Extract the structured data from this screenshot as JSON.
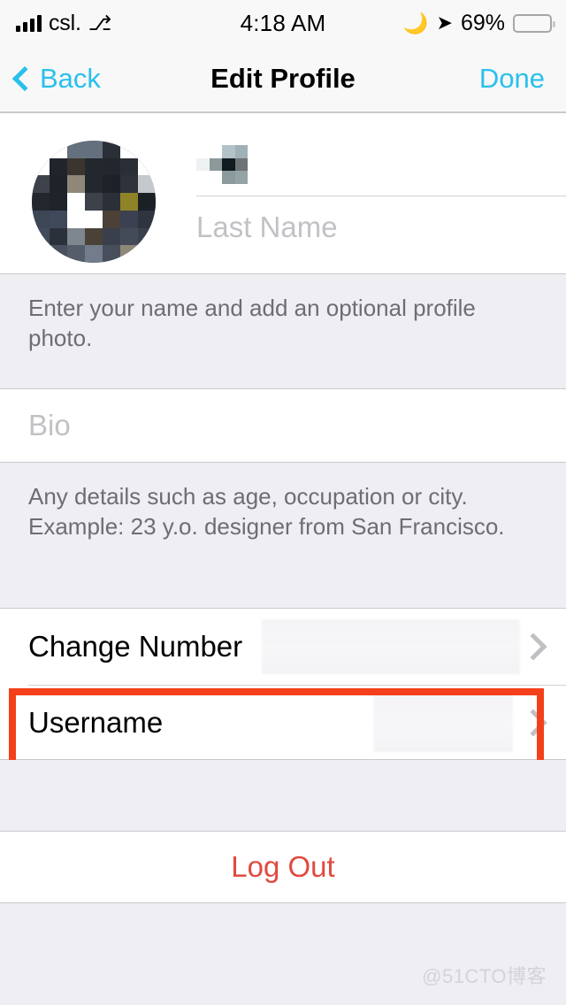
{
  "status_bar": {
    "carrier": "csl.",
    "signal_icon": "signal-bars-icon",
    "wifi_icon": "wifi-icon",
    "time": "4:18 AM",
    "dnd_icon": "moon-icon",
    "location_icon": "location-arrow-icon",
    "battery_percent": "69%",
    "battery_color": "#fdd017"
  },
  "nav_bar": {
    "back_label": "Back",
    "back_icon": "chevron-left-icon",
    "title": "Edit Profile",
    "done_label": "Done",
    "accent_color": "#2ac0ec"
  },
  "profile": {
    "avatar_name": "profile-photo-redacted",
    "first_name_value": "",
    "first_name_redacted": true,
    "last_name_placeholder": "Last Name",
    "help_text": "Enter your name and add an optional profile photo."
  },
  "bio": {
    "placeholder": "Bio",
    "value": "",
    "help_text": "Any details such as age, occupation or city. Example: 23 y.o. designer from San Francisco."
  },
  "settings": {
    "rows": [
      {
        "label": "Change Number",
        "value": "",
        "value_redacted": true,
        "chevron": "chevron-right-icon"
      },
      {
        "label": "Username",
        "value": "",
        "value_redacted": true,
        "chevron": "chevron-right-icon"
      }
    ]
  },
  "highlight": {
    "target": "Username",
    "color": "#f4401a"
  },
  "logout": {
    "label": "Log Out",
    "color": "#e04a3f"
  },
  "watermark": {
    "text": "@51CTO博客"
  }
}
